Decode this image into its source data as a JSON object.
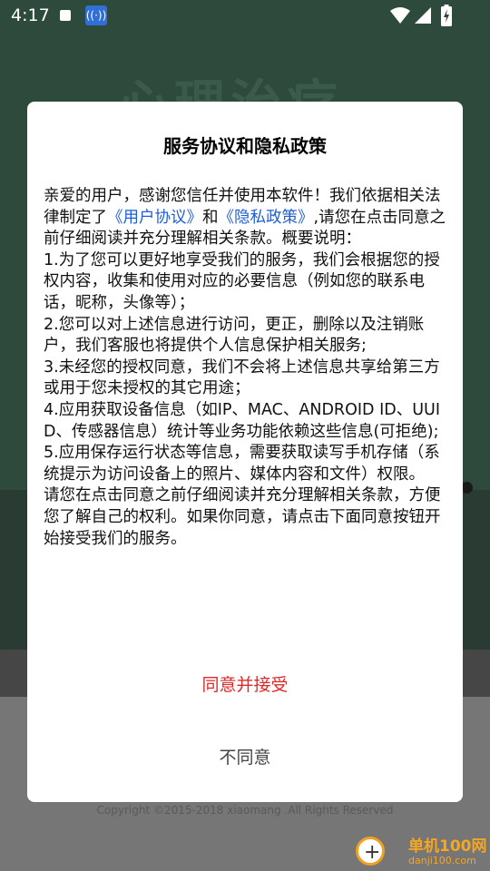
{
  "status_bar": {
    "time": "4:17"
  },
  "background": {
    "title": "心理治疗",
    "copyright": "Copyright ©2015-2018 xiaomang .All Rights Reserved"
  },
  "dialog": {
    "title": "服务协议和隐私政策",
    "intro_1": "亲爱的用户，感谢您信任并使用本软件！我们依据相关法律制定了",
    "link_user_agreement": "《用户协议》",
    "intro_2": "和",
    "link_privacy_policy": "《隐私政策》",
    "intro_3": ",请您在点击同意之前仔细阅读并充分理解相关条款。概要说明：",
    "items": [
      "1.为了您可以更好地享受我们的服务，我们会根据您的授权内容，收集和使用对应的必要信息（例如您的联系电话，昵称，头像等）；",
      "2.您可以对上述信息进行访问，更正，删除以及注销账户，我们客服也将提供个人信息保护相关服务;",
      "3.未经您的授权同意，我们不会将上述信息共享给第三方或用于您未授权的其它用途；",
      "4.应用获取设备信息（如IP、MAC、ANDROID ID、UUID、传感器信息）统计等业务功能依赖这些信息(可拒绝);",
      "5.应用保存运行状态等信息，需要获取读写手机存储（系统提示为访问设备上的照片、媒体内容和文件）权限。"
    ],
    "closing": "请您在点击同意之前仔细阅读并充分理解相关条款，方便您了解自己的权利。如果你同意，请点击下面同意按钮开始接受我们的服务。",
    "agree_label": "同意并接受",
    "disagree_label": "不同意"
  },
  "watermark": {
    "name": "单机100网",
    "url": "danji100.com"
  }
}
